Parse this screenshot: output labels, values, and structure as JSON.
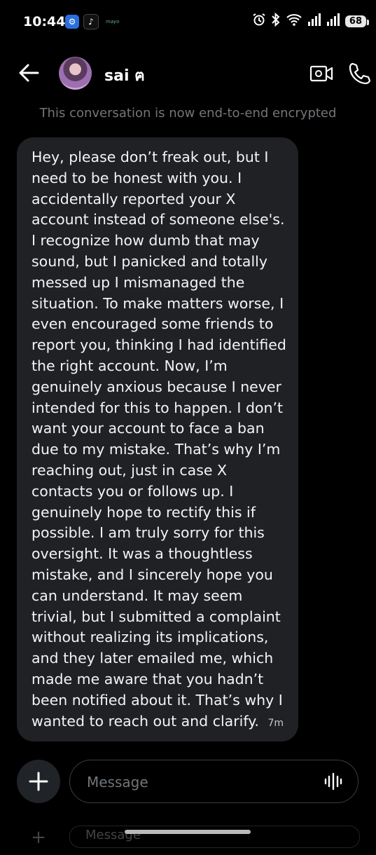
{
  "status_bar": {
    "time": "10:44",
    "notif_text": "mayo",
    "battery": "68",
    "icons": [
      "vpn-app-icon",
      "tiktok-icon",
      "alarm-icon",
      "bluetooth-icon",
      "wifi-icon",
      "signal-icon",
      "signal-icon-2",
      "battery-icon"
    ]
  },
  "header": {
    "contact_name": "sai ฅ",
    "icons": [
      "back-arrow-icon",
      "video-call-icon",
      "phone-call-icon"
    ]
  },
  "conversation": {
    "encryption_notice": "This conversation is now end-to-end encrypted",
    "messages": [
      {
        "text": "Hey, please don’t freak out, but I\nneed to be honest with you. I\naccidentally reported your X\naccount instead of someone else's.\nI recognize how dumb that may\nsound, but I panicked and totally\nmessed up I mismanaged the\nsituation. To make matters worse, I\neven encouraged some friends to\nreport you, thinking I had identified\nthe right account. Now, I’m\ngenuinely anxious because I never\nintended for this to happen. I don’t\nwant your account to face a ban\ndue to my mistake. That’s why I’m\nreaching out, just in case X\ncontacts you or follows up. I\ngenuinely hope to rectify this if\npossible. I am truly sorry for this\noversight. It was a thoughtless\nmistake, and I sincerely hope you\ncan understand. It may seem\ntrivial, but I submitted a complaint\nwithout realizing its implications,\nand they later emailed me, which\nmade me aware that you hadn’t\nbeen notified about it. That’s why I\nwanted to reach out and clarify.",
        "time": "7m"
      }
    ]
  },
  "composer": {
    "placeholder": "Message",
    "icons": [
      "plus-icon",
      "voice-waveform-icon"
    ]
  },
  "ghost_composer": {
    "text": "Message"
  },
  "colors": {
    "background": "#000000",
    "bubble": "#1f2124",
    "muted": "#71767b"
  }
}
